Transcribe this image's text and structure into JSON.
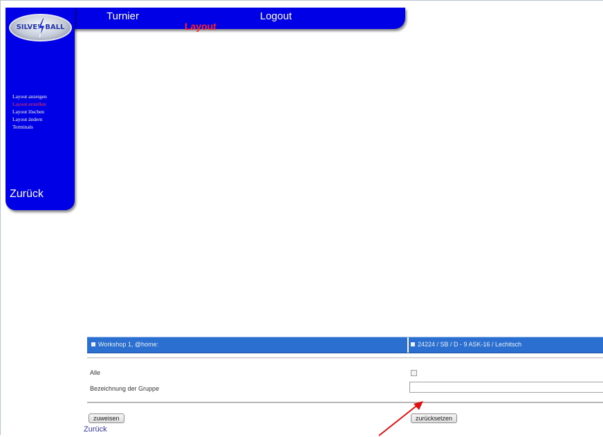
{
  "nav": {
    "links": [
      "Turnier",
      "Logout"
    ],
    "current_section": "Layout"
  },
  "logo": {
    "text": "SILVER BALL"
  },
  "sidebar": {
    "items": [
      {
        "label": "Layout anzeigen",
        "active": false
      },
      {
        "label": "Layout erstellen",
        "active": true
      },
      {
        "label": "Layout löschen",
        "active": false
      },
      {
        "label": "Layout ändern",
        "active": false
      },
      {
        "label": "Terminals",
        "active": false
      }
    ],
    "back_label": "Zurück"
  },
  "form": {
    "header": {
      "left": "Workshop 1, @home:",
      "right": "24224 / SB / D - 9 ASK-16 / Lechitsch"
    },
    "rows": {
      "alle_label": "Alle",
      "group_label": "Bezeichnung der Gruppe",
      "group_value": ""
    },
    "buttons": {
      "assign": "zuweisen",
      "reset": "zurücksetzen"
    },
    "back_link": "Zurück"
  },
  "colors": {
    "nav_blue": "#0000e6",
    "header_blue": "#2b6fd0",
    "active_red": "#ff3355",
    "arrow_red": "#e01010"
  },
  "icons": [
    "lightning-bolt-icon",
    "square-bullet-icon",
    "red-arrow-annotation"
  ]
}
